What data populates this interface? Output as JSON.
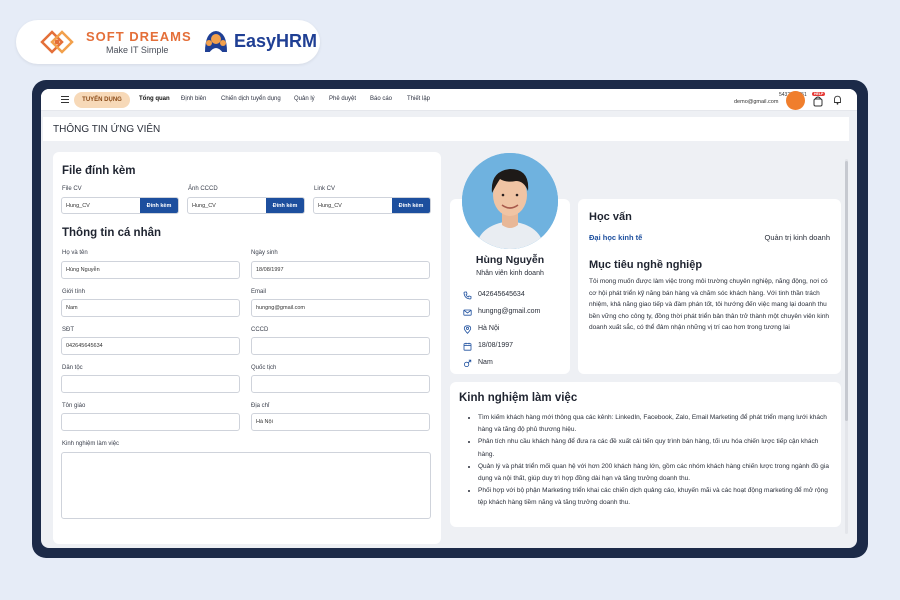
{
  "branding": {
    "softdreams_name": "SOFT DREAMS",
    "softdreams_tagline": "Make IT Simple",
    "easyhrm_name": "EasyHRM"
  },
  "nav": {
    "highlight": "TUYỂN DỤNG",
    "items": [
      "Tổng quan",
      "Định biên",
      "Chiến dịch tuyển dụng",
      "Quản lý",
      "Phê duyệt",
      "Báo cáo",
      "Thiết lập"
    ],
    "account_phone": "5432534251",
    "account_email": "demo@gmail.com",
    "help_badge": "HELP"
  },
  "page": {
    "title": "THÔNG TIN ỨNG VIÊN"
  },
  "attachments": {
    "title": "File đính kèm",
    "attach_label": "Đính kèm",
    "fields": [
      {
        "label": "File CV",
        "value": "Hung_CV"
      },
      {
        "label": "Ảnh CCCD",
        "value": "Hung_CV"
      },
      {
        "label": "Link CV",
        "value": "Hung_CV"
      }
    ]
  },
  "personal": {
    "title": "Thông tin cá nhân",
    "full_name_label": "Họ và tên",
    "full_name": "Hùng Nguyễn",
    "dob_label": "Ngày sinh",
    "dob": "18/08/1997",
    "gender_label": "Giới tính",
    "gender": "Nam",
    "email_label": "Email",
    "email": "hungng@gmail.com",
    "phone_label": "SĐT",
    "phone": "042645645634",
    "cccd_label": "CCCD",
    "cccd": "",
    "ethnic_label": "Dân tộc",
    "ethnic": "",
    "nationality_label": "Quốc tịch",
    "nationality": "",
    "religion_label": "Tôn giáo",
    "religion": "",
    "address_label": "Địa chỉ",
    "address": "Hà Nội",
    "experience_label": "Kinh nghiệm làm việc"
  },
  "profile": {
    "name": "Hùng Nguyễn",
    "role": "Nhân viên kinh doanh",
    "phone": "042645645634",
    "email": "hungng@gmail.com",
    "location": "Hà Nội",
    "dob": "18/08/1997",
    "gender": "Nam"
  },
  "education": {
    "title": "Học vấn",
    "university": "Đại học kinh tế",
    "major": "Quản trị kinh doanh",
    "objective_title": "Mục tiêu nghề nghiệp",
    "objective": "Tôi mong muốn được làm việc trong môi trường chuyên nghiệp, năng động, nơi có cơ hội phát triển kỹ năng bán hàng và chăm sóc khách hàng. Với tinh thần trách nhiệm, khả năng giao tiếp và đàm phán tốt, tôi hướng đến việc mang lại doanh thu bền vững cho công ty, đồng thời phát triển bản thân trở thành một chuyên viên kinh doanh xuất sắc, có thể đảm nhận những vị trí cao hơn trong tương lai"
  },
  "experience": {
    "title": "Kinh nghiệm làm việc",
    "items": [
      "Tìm kiếm khách hàng mới thông qua các kênh: LinkedIn, Facebook, Zalo, Email Marketing để phát triển mạng lưới khách hàng và tăng độ phủ thương hiệu.",
      "Phân tích nhu cầu khách hàng để đưa ra các đề xuất cải tiến quy trình bán hàng, tối ưu hóa chiến lược tiếp cận khách hàng.",
      "Quản lý và phát triển mối quan hệ với hơn 200 khách hàng lớn, gồm các nhóm khách hàng chiến lược trong ngành đồ gia dụng và nội thất, giúp duy trì hợp đồng dài hạn và tăng trưởng doanh thu.",
      "Phối hợp với bộ phận Marketing triển khai các chiến dịch quảng cáo, khuyến mãi và các hoạt động marketing để mở rộng tệp khách hàng tiềm năng và tăng trưởng doanh thu."
    ]
  },
  "colors": {
    "primary": "#1d4f9e",
    "accent_orange": "#f07e2c",
    "frame": "#1c2a48",
    "background": "#e6ecf7"
  }
}
